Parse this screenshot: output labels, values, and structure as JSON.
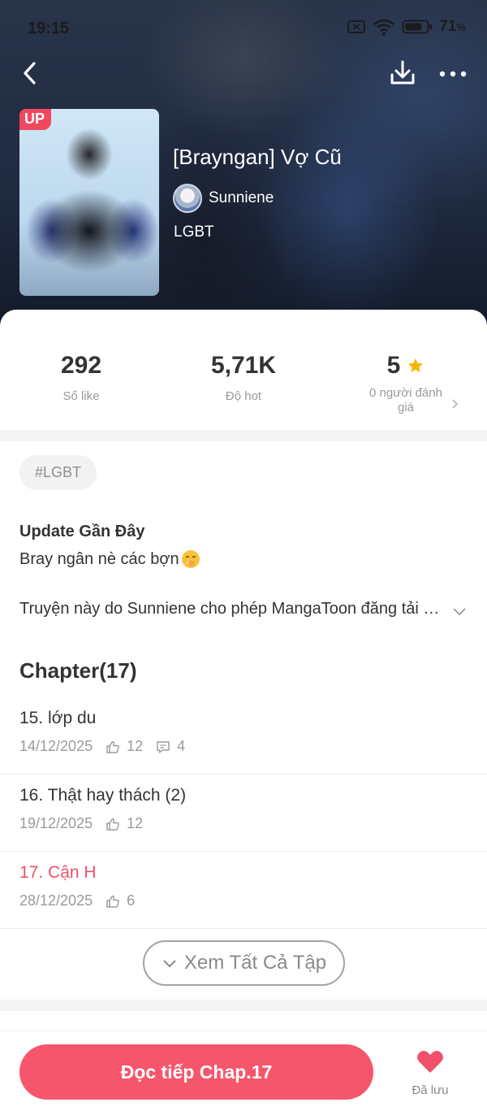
{
  "status_bar": {
    "time": "19:15",
    "battery_percent": "71",
    "battery_unit": "%"
  },
  "book": {
    "badge": "UP",
    "title": "[Brayngan] Vợ Cũ",
    "author": "Sunniene",
    "genre": "LGBT"
  },
  "stats": {
    "likes": {
      "value": "292",
      "label": "Số like"
    },
    "hot": {
      "value": "5,71K",
      "label": "Độ hot"
    },
    "rating": {
      "value": "5",
      "label_line1": "0 người đánh",
      "label_line2": "giá"
    }
  },
  "tags": [
    "#LGBT"
  ],
  "update": {
    "title": "Update Gần Đây",
    "body": "Bray ngân nè các bợn"
  },
  "description": "Truyện này do Sunniene cho phép MangaToon đăng tải độc quyền.",
  "chapters": {
    "heading": "Chapter(17)",
    "items": [
      {
        "title": "15. lớp du",
        "date": "14/12/2025",
        "likes": "12",
        "comments": "4"
      },
      {
        "title": "16. Thật hay thách (2)",
        "date": "19/12/2025",
        "likes": "12"
      },
      {
        "title": "17. Cận H",
        "date": "28/12/2025",
        "likes": "6"
      }
    ],
    "see_all": "Xem Tất Cả Tập"
  },
  "bottom": {
    "read_button": "Đọc tiếp Chap.17",
    "saved_label": "Đã lưu"
  },
  "colors": {
    "accent": "#f5566c",
    "current_chapter": "#f0506a",
    "star": "#f7b500"
  },
  "icons": [
    "back-arrow-icon",
    "download-icon",
    "more-icon",
    "star-icon",
    "chevron-right-icon",
    "chevron-down-icon",
    "like-icon",
    "comment-icon",
    "heart-icon",
    "wifi-icon",
    "battery-icon",
    "sim-off-icon"
  ]
}
